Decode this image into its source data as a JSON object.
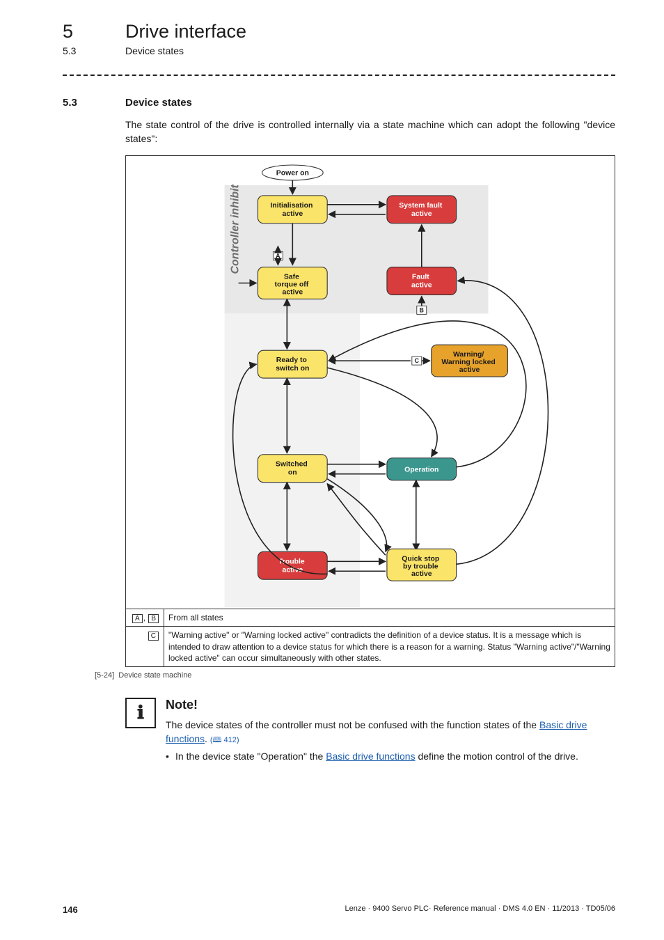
{
  "header": {
    "chapter_num": "5",
    "chapter_title": "Drive interface",
    "sub_num": "5.3",
    "sub_title": "Device states"
  },
  "section": {
    "num": "5.3",
    "title": "Device states",
    "intro": "The state control of the drive is controlled internally via a state machine which can adopt the following \"device states\":"
  },
  "diagram": {
    "inhibit_label": "Controller inhibit",
    "power_on": "Power on",
    "states": {
      "init": "Initialisation active",
      "sysfault": "System fault active",
      "safeoff": "Safe torque off active",
      "fault": "Fault active",
      "ready": "Ready to switch on",
      "warn": "Warning/ Warning locked active",
      "switched": "Switched on",
      "operation": "Operation",
      "trouble": "Trouble active",
      "quickstop": "Quick stop by trouble active"
    },
    "markers": {
      "a": "A",
      "b": "B",
      "c": "C"
    },
    "legend": {
      "ab_keys": "A  B",
      "ab_text": "From all states",
      "c_key": "C",
      "c_text": "\"Warning active\" or \"Warning locked active\" contradicts the definition of a device status. It is a message which is intended to draw attention to a device status for which there is a reason for a warning. Status \"Warning active\"/\"Warning locked active\" can occur simultaneously with other states."
    }
  },
  "figure_caption": {
    "num": "[5-24]",
    "text": "Device state machine"
  },
  "note": {
    "title": "Note!",
    "body_pre": "The device states of the controller must not be confused with the function states of the ",
    "link1": "Basic drive functions",
    "ref": " 412)",
    "bullet_pre": "In the device state \"Operation\" the ",
    "link2": "Basic drive functions",
    "bullet_post": " define the motion control of the drive."
  },
  "footer": {
    "page": "146",
    "text": "Lenze · 9400 Servo PLC· Reference manual · DMS 4.0 EN · 11/2013 · TD05/06"
  }
}
